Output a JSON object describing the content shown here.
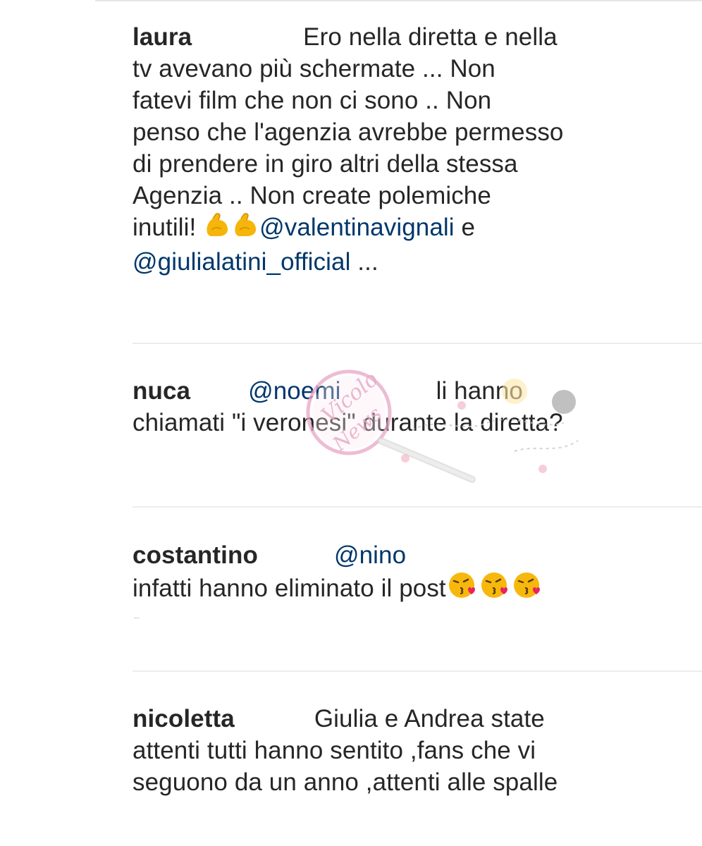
{
  "comments": [
    {
      "username": "laura",
      "lines": [
        "Ero nella diretta e nella",
        "tv avevano più  schermate ... Non",
        "fatevi film che non ci sono .. Non",
        "penso che l'agenzia avrebbe permesso",
        "di prendere in giro altri della stessa",
        "Agenzia .. Non create polemiche"
      ],
      "line7_text": "inutili! ",
      "emoji": [
        "flexed-biceps-icon",
        "flexed-biceps-icon"
      ],
      "mention1": "@valentinavignali",
      "connector": " e",
      "mention2": "@giulialatini_official",
      "trailing": " ..."
    },
    {
      "username": "nuca",
      "mention": "@noemi",
      "text_first": "li hanno",
      "text_second": "chiamati \"i veronesi\" durante la diretta?"
    },
    {
      "username": "costantino",
      "mention": "@nino",
      "text": "infatti hanno eliminato il post",
      "emoji": [
        "face-blowing-kiss-icon",
        "face-blowing-kiss-icon",
        "face-blowing-kiss-icon"
      ]
    },
    {
      "username": "nicoletta",
      "lines": [
        "Giulia e Andrea state",
        "attenti tutti hanno sentito ,fans che vi",
        "seguono da un anno ,attenti alle spalle"
      ]
    }
  ],
  "watermark": {
    "text_top": "Vicolo",
    "text_bottom": "News",
    "color": "#e7a6c6"
  },
  "colors": {
    "text": "#262626",
    "mention": "#00376b",
    "divider": "#ececec"
  }
}
